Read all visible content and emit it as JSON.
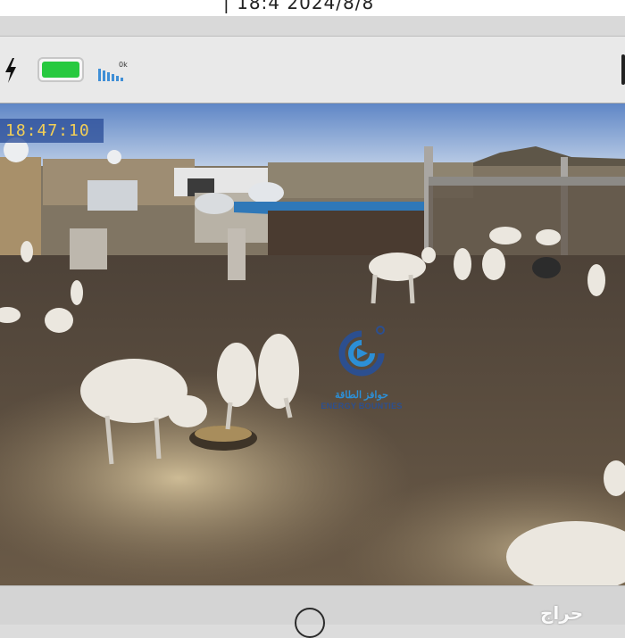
{
  "top_bar": {
    "date_text": "| 18:4 2024/8/8"
  },
  "status_bar": {
    "battery_level": 1.0,
    "battery_color": "#27c93f",
    "signal_tag": "0k",
    "icons": [
      "bolt-icon",
      "battery-icon",
      "signal-bars-icon"
    ]
  },
  "video": {
    "timestamp": "18:47:10",
    "watermark_arabic": "حوافز الطاقة",
    "watermark_english": "ENERGY BOUNTIES"
  },
  "nav_bar": {
    "brand": "حراج",
    "icons": [
      "home-button-icon"
    ]
  }
}
